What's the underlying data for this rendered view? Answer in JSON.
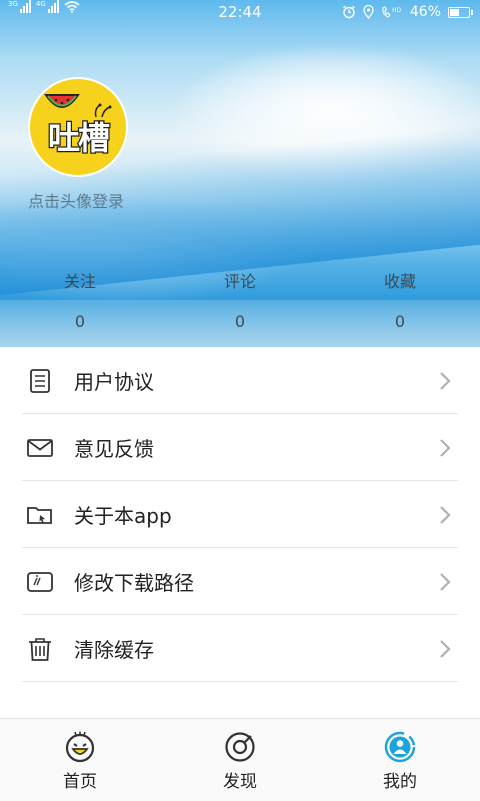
{
  "status_bar": {
    "time": "22:44",
    "battery": "46%",
    "signal_labels": [
      "3G",
      "4G"
    ],
    "icons": [
      "signal-icon",
      "wifi-icon",
      "alarm-icon",
      "location-icon",
      "hd-call-icon",
      "battery-icon"
    ]
  },
  "profile": {
    "avatar_logo_text": "吐槽",
    "login_hint": "点击头像登录"
  },
  "stats": [
    {
      "label": "关注",
      "value": "0"
    },
    {
      "label": "评论",
      "value": "0"
    },
    {
      "label": "收藏",
      "value": "0"
    }
  ],
  "menu": [
    {
      "label": "用户协议",
      "icon": "document-icon"
    },
    {
      "label": "意见反馈",
      "icon": "mail-icon"
    },
    {
      "label": "关于本app",
      "icon": "folder-icon"
    },
    {
      "label": "修改下载路径",
      "icon": "sd-card-icon"
    },
    {
      "label": "清除缓存",
      "icon": "trash-icon"
    }
  ],
  "tabs": [
    {
      "label": "首页",
      "icon": "smiley-icon",
      "active": false
    },
    {
      "label": "发现",
      "icon": "compass-icon",
      "active": false
    },
    {
      "label": "我的",
      "icon": "user-icon",
      "active": true
    }
  ],
  "colors": {
    "active_tab": "#1aa3dc",
    "avatar_bg": "#f6d21c",
    "text": "#222222",
    "chevron": "#b0b0b0"
  }
}
